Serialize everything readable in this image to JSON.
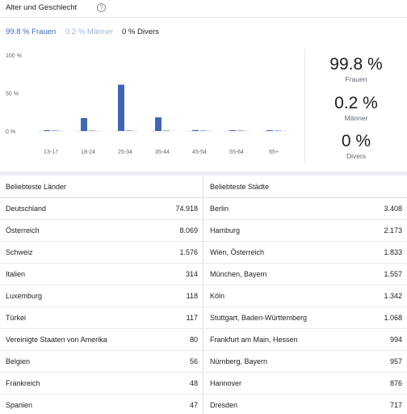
{
  "header": {
    "title": "Alter und Geschlecht",
    "help_glyph": "?"
  },
  "filters": {
    "women": "99.8 % Frauen",
    "men": "0.2 % Männer",
    "diverse": "0 % Divers"
  },
  "colors": {
    "women": "#4267b2",
    "men": "#9cb4d8",
    "diverse": "#1c1e21",
    "grid": "#e4e6eb"
  },
  "chart_data": {
    "type": "bar",
    "categories": [
      "13-17",
      "18-24",
      "25-34",
      "35-44",
      "45-54",
      "55-64",
      "65+"
    ],
    "series": [
      {
        "name": "Frauen",
        "values": [
          0.3,
          17,
          61,
          18,
          1.2,
          0.4,
          0.3
        ]
      },
      {
        "name": "Männer",
        "values": [
          0.3,
          0.3,
          0.5,
          0.3,
          0.2,
          0.2,
          0.2
        ]
      }
    ],
    "y_ticks": [
      "100 %",
      "50 %",
      "0 %"
    ],
    "ylim": [
      0,
      100
    ],
    "grid": false,
    "title": "",
    "xlabel": "",
    "ylabel": ""
  },
  "summary": [
    {
      "value": "99.8 %",
      "label": "Frauen"
    },
    {
      "value": "0.2 %",
      "label": "Männer"
    },
    {
      "value": "0 %",
      "label": "Divers"
    }
  ],
  "countries": {
    "header": "Beliebteste Länder",
    "rows": [
      {
        "name": "Deutschland",
        "value": "74.918"
      },
      {
        "name": "Österreich",
        "value": "8.069"
      },
      {
        "name": "Schweiz",
        "value": "1.576"
      },
      {
        "name": "Italien",
        "value": "314"
      },
      {
        "name": "Luxemburg",
        "value": "118"
      },
      {
        "name": "Türkei",
        "value": "117"
      },
      {
        "name": "Vereinigte Staaten von Amerika",
        "value": "80"
      },
      {
        "name": "Belgien",
        "value": "56"
      },
      {
        "name": "Frankreich",
        "value": "48"
      },
      {
        "name": "Spanien",
        "value": "47"
      }
    ]
  },
  "cities": {
    "header": "Beliebteste Städte",
    "rows": [
      {
        "name": "Berlin",
        "value": "3.408"
      },
      {
        "name": "Hamburg",
        "value": "2.173"
      },
      {
        "name": "Wien, Österreich",
        "value": "1.833"
      },
      {
        "name": "München, Bayern",
        "value": "1.557"
      },
      {
        "name": "Köln",
        "value": "1.342"
      },
      {
        "name": "Stuttgart, Baden-Württemberg",
        "value": "1.068"
      },
      {
        "name": "Frankfurt am Main, Hessen",
        "value": "994"
      },
      {
        "name": "Nürnberg, Bayern",
        "value": "957"
      },
      {
        "name": "Hannover",
        "value": "876"
      },
      {
        "name": "Dresden",
        "value": "717"
      }
    ]
  }
}
